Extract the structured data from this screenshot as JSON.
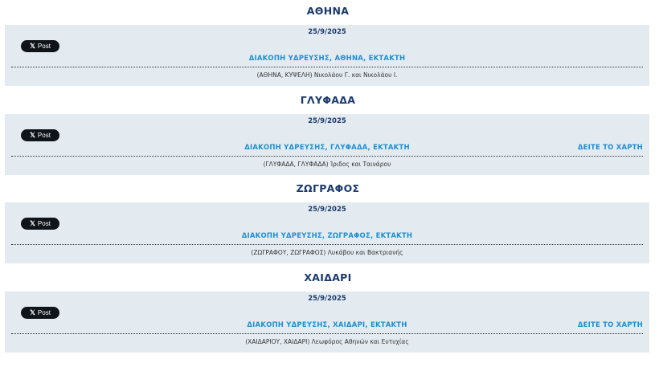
{
  "post_button_label": "Post",
  "post_icon": "x-logo-icon",
  "regions": [
    {
      "name": "ΑΘΗΝΑ",
      "date": "25/9/2025",
      "title": "ΔΙΑΚΟΠΗ ΥΔΡΕΥΣΗΣ, ΑΘΗΝΑ, ΕΚΤΑΚΤΗ",
      "map_link": "",
      "streets": "(ΑΘΗΝΑ, ΚΥΨΕΛΗ) Νικολάου Γ. και Νικολάου Ι."
    },
    {
      "name": "ΓΛΥΦΑΔΑ",
      "date": "25/9/2025",
      "title": "ΔΙΑΚΟΠΗ ΥΔΡΕΥΣΗΣ, ΓΛΥΦΑΔΑ, ΕΚΤΑΚΤΗ",
      "map_link": "ΔΕΙΤΕ ΤΟ ΧΑΡΤΗ",
      "streets": "(ΓΛΥΦΑΔΑ, ΓΛΥΦΑΔΑ) Ίριδος και Ταινάρου"
    },
    {
      "name": "ΖΩΓΡΑΦΟΣ",
      "date": "25/9/2025",
      "title": "ΔΙΑΚΟΠΗ ΥΔΡΕΥΣΗΣ, ΖΩΓΡΑΦΟΣ, ΕΚΤΑΚΤΗ",
      "map_link": "",
      "streets": "(ΖΩΓΡΑΦΟΥ, ΖΩΓΡΑΦΟΣ) Λυκάβου και Βακτριανής"
    },
    {
      "name": "ΧΑΙΔΑΡΙ",
      "date": "25/9/2025",
      "title": "ΔΙΑΚΟΠΗ ΥΔΡΕΥΣΗΣ, ΧΑΙΔΑΡΙ, ΕΚΤΑΚΤΗ",
      "map_link": "ΔΕΙΤΕ ΤΟ ΧΑΡΤΗ",
      "streets": "(ΧΑΙΔΑΡΙΟΥ, ΧΑΙΔΑΡΙ) Λεωφόρος Αθηνών και Ευτυχίας"
    }
  ]
}
